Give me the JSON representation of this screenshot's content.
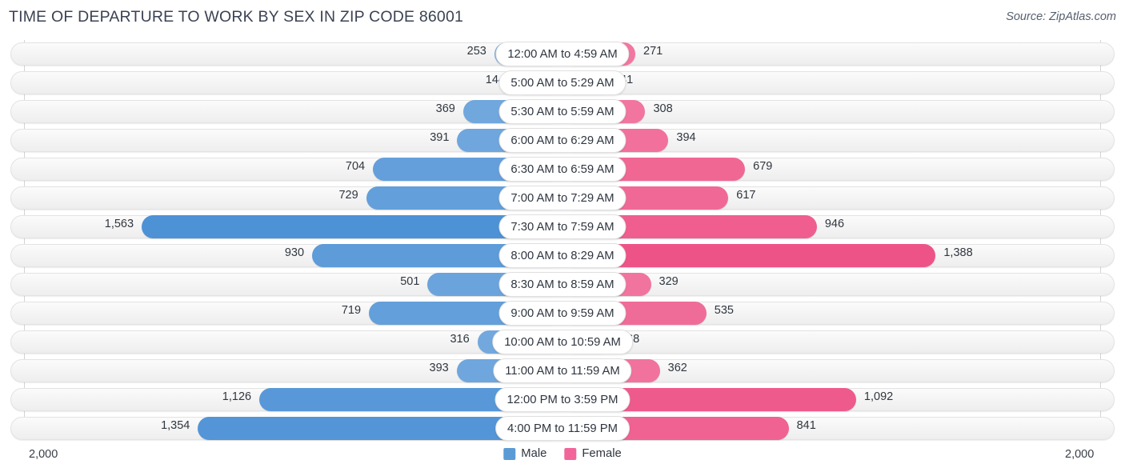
{
  "header": {
    "title": "TIME OF DEPARTURE TO WORK BY SEX IN ZIP CODE 86001",
    "source": "Source: ZipAtlas.com"
  },
  "axis": {
    "left_end_label": "2,000",
    "right_end_label": "2,000",
    "max": 2000
  },
  "legend": {
    "items": [
      {
        "label": "Male",
        "color": "#5b9bd5"
      },
      {
        "label": "Female",
        "color": "#f2659a"
      }
    ]
  },
  "chart_data": {
    "type": "bar",
    "subtype": "diverging-bidirectional-bar",
    "title": "TIME OF DEPARTURE TO WORK BY SEX IN ZIP CODE 86001",
    "subtitle": "",
    "xlabel": "",
    "ylabel": "",
    "xlim": [
      2000,
      2000
    ],
    "axis_max": 2000,
    "grid": true,
    "legend_position": "bottom-center",
    "categories": [
      "12:00 AM to 4:59 AM",
      "5:00 AM to 5:29 AM",
      "5:30 AM to 5:59 AM",
      "6:00 AM to 6:29 AM",
      "6:30 AM to 6:59 AM",
      "7:00 AM to 7:29 AM",
      "7:30 AM to 7:59 AM",
      "8:00 AM to 8:29 AM",
      "8:30 AM to 8:59 AM",
      "9:00 AM to 9:59 AM",
      "10:00 AM to 10:59 AM",
      "11:00 AM to 11:59 AM",
      "12:00 PM to 3:59 PM",
      "4:00 PM to 11:59 PM"
    ],
    "series": [
      {
        "name": "Male",
        "color": "#5b9bd5",
        "direction": "left",
        "values": [
          253,
          144,
          369,
          391,
          704,
          729,
          1563,
          930,
          501,
          719,
          316,
          393,
          1126,
          1354
        ],
        "labels": [
          "253",
          "144",
          "369",
          "391",
          "704",
          "729",
          "1,563",
          "930",
          "501",
          "719",
          "316",
          "393",
          "1,126",
          "1,354"
        ]
      },
      {
        "name": "Female",
        "color": "#f2659a",
        "direction": "right",
        "values": [
          271,
          41,
          308,
          394,
          679,
          617,
          946,
          1388,
          329,
          535,
          168,
          362,
          1092,
          841
        ],
        "labels": [
          "271",
          "41",
          "308",
          "394",
          "679",
          "617",
          "946",
          "1,388",
          "329",
          "535",
          "168",
          "362",
          "1,092",
          "841"
        ]
      }
    ],
    "rows": [
      {
        "label": "12:00 AM to 4:59 AM",
        "male": 253,
        "male_label": "253",
        "female": 271,
        "female_label": "271"
      },
      {
        "label": "5:00 AM to 5:29 AM",
        "male": 144,
        "male_label": "144",
        "female": 41,
        "female_label": "41"
      },
      {
        "label": "5:30 AM to 5:59 AM",
        "male": 369,
        "male_label": "369",
        "female": 308,
        "female_label": "308"
      },
      {
        "label": "6:00 AM to 6:29 AM",
        "male": 391,
        "male_label": "391",
        "female": 394,
        "female_label": "394"
      },
      {
        "label": "6:30 AM to 6:59 AM",
        "male": 704,
        "male_label": "704",
        "female": 679,
        "female_label": "679"
      },
      {
        "label": "7:00 AM to 7:29 AM",
        "male": 729,
        "male_label": "729",
        "female": 617,
        "female_label": "617"
      },
      {
        "label": "7:30 AM to 7:59 AM",
        "male": 1563,
        "male_label": "1,563",
        "female": 946,
        "female_label": "946"
      },
      {
        "label": "8:00 AM to 8:29 AM",
        "male": 930,
        "male_label": "930",
        "female": 1388,
        "female_label": "1,388"
      },
      {
        "label": "8:30 AM to 8:59 AM",
        "male": 501,
        "male_label": "501",
        "female": 329,
        "female_label": "329"
      },
      {
        "label": "9:00 AM to 9:59 AM",
        "male": 719,
        "male_label": "719",
        "female": 535,
        "female_label": "535"
      },
      {
        "label": "10:00 AM to 10:59 AM",
        "male": 316,
        "male_label": "316",
        "female": 168,
        "female_label": "168"
      },
      {
        "label": "11:00 AM to 11:59 AM",
        "male": 393,
        "male_label": "393",
        "female": 362,
        "female_label": "362"
      },
      {
        "label": "12:00 PM to 3:59 PM",
        "male": 1126,
        "male_label": "1,126",
        "female": 1092,
        "female_label": "1,092"
      },
      {
        "label": "4:00 PM to 11:59 PM",
        "male": 1354,
        "male_label": "1,354",
        "female": 841,
        "female_label": "841"
      }
    ]
  }
}
